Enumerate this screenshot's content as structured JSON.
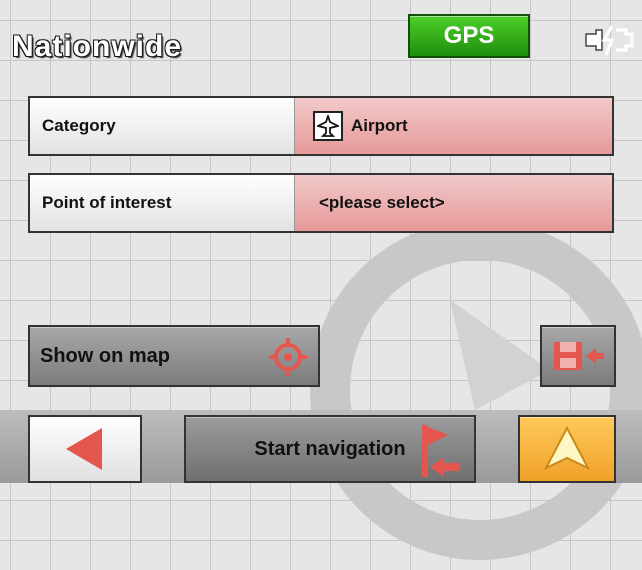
{
  "header": {
    "title": "Nationwide",
    "gps_label": "GPS"
  },
  "fields": {
    "category": {
      "label": "Category",
      "value": "Airport"
    },
    "poi": {
      "label": "Point of interest",
      "value": "<please select>"
    }
  },
  "buttons": {
    "show_on_map": "Show on map",
    "start_navigation": "Start navigation"
  },
  "icons": {
    "gps": "gps-badge",
    "power": "power-plug-icon",
    "category": "airplane-icon",
    "show_on_map": "crosshair-icon",
    "save": "save-to-favorites-icon",
    "back": "left-arrow-icon",
    "navigation": "flag-arrow-icon",
    "options": "navigation-arrow-icon"
  },
  "colors": {
    "gps_green": "#2fb018",
    "field_value_bg": "#eaa8a8",
    "accent_red": "#e5564e",
    "accent_orange": "#f4b43c"
  }
}
